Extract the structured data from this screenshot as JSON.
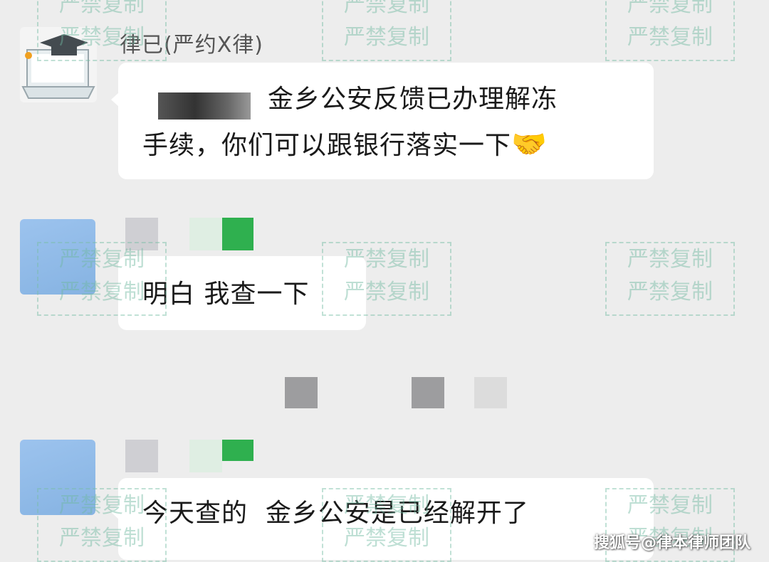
{
  "chat": {
    "sender_name": "律已(严约X律)",
    "messages": [
      {
        "line1": "金乡公安反馈已办理解冻",
        "line2": "手续，你们可以跟银行落实一下",
        "emoji": "🤝"
      },
      {
        "text": "明白 我查一下"
      },
      {
        "text": "今天查的  金乡公安是已经解开了"
      }
    ]
  },
  "watermark": {
    "line1": "严禁复制",
    "line2": "严禁复制"
  },
  "footer": {
    "source": "搜狐号@律本律师团队"
  },
  "colors": {
    "background": "#ededed",
    "bubble": "#ffffff",
    "watermark": "#6eb9a0",
    "censor_green": "#2fb04f",
    "avatar_blue": "#8db9e6"
  }
}
